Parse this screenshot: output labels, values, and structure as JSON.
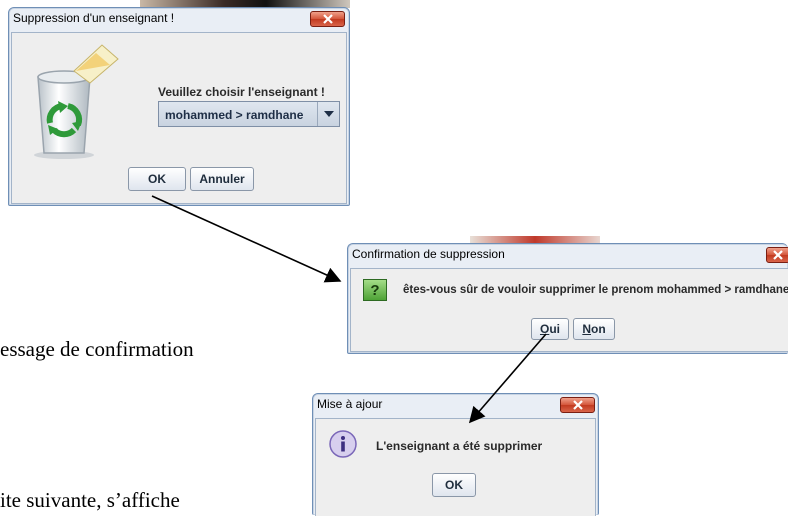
{
  "document": {
    "line1": "essage de confirmation",
    "line2": "ite suivante, s’affiche"
  },
  "dialog_delete": {
    "title": "Suppression d'un enseignant !",
    "prompt": "Veuillez choisir l'enseignant !",
    "selected": "mohammed > ramdhane",
    "ok_label": "OK",
    "cancel_label": "Annuler",
    "icon": "recycle-bin-icon"
  },
  "dialog_confirm": {
    "title": "Confirmation de suppression",
    "message": "êtes-vous sûr de vouloir supprimer le prenom mohammed > ramdhane ?",
    "icon": "question-icon",
    "yes_first": "O",
    "yes_rest": "ui",
    "no_first": "N",
    "no_rest": "on"
  },
  "dialog_update": {
    "title": "Mise à ajour",
    "message": "L'enseignant a été supprimer",
    "ok_label": "OK",
    "icon": "info-icon"
  },
  "colors": {
    "close_button": "#d4553a",
    "title_bar": "#e9eef5",
    "arrow": "#000000"
  }
}
